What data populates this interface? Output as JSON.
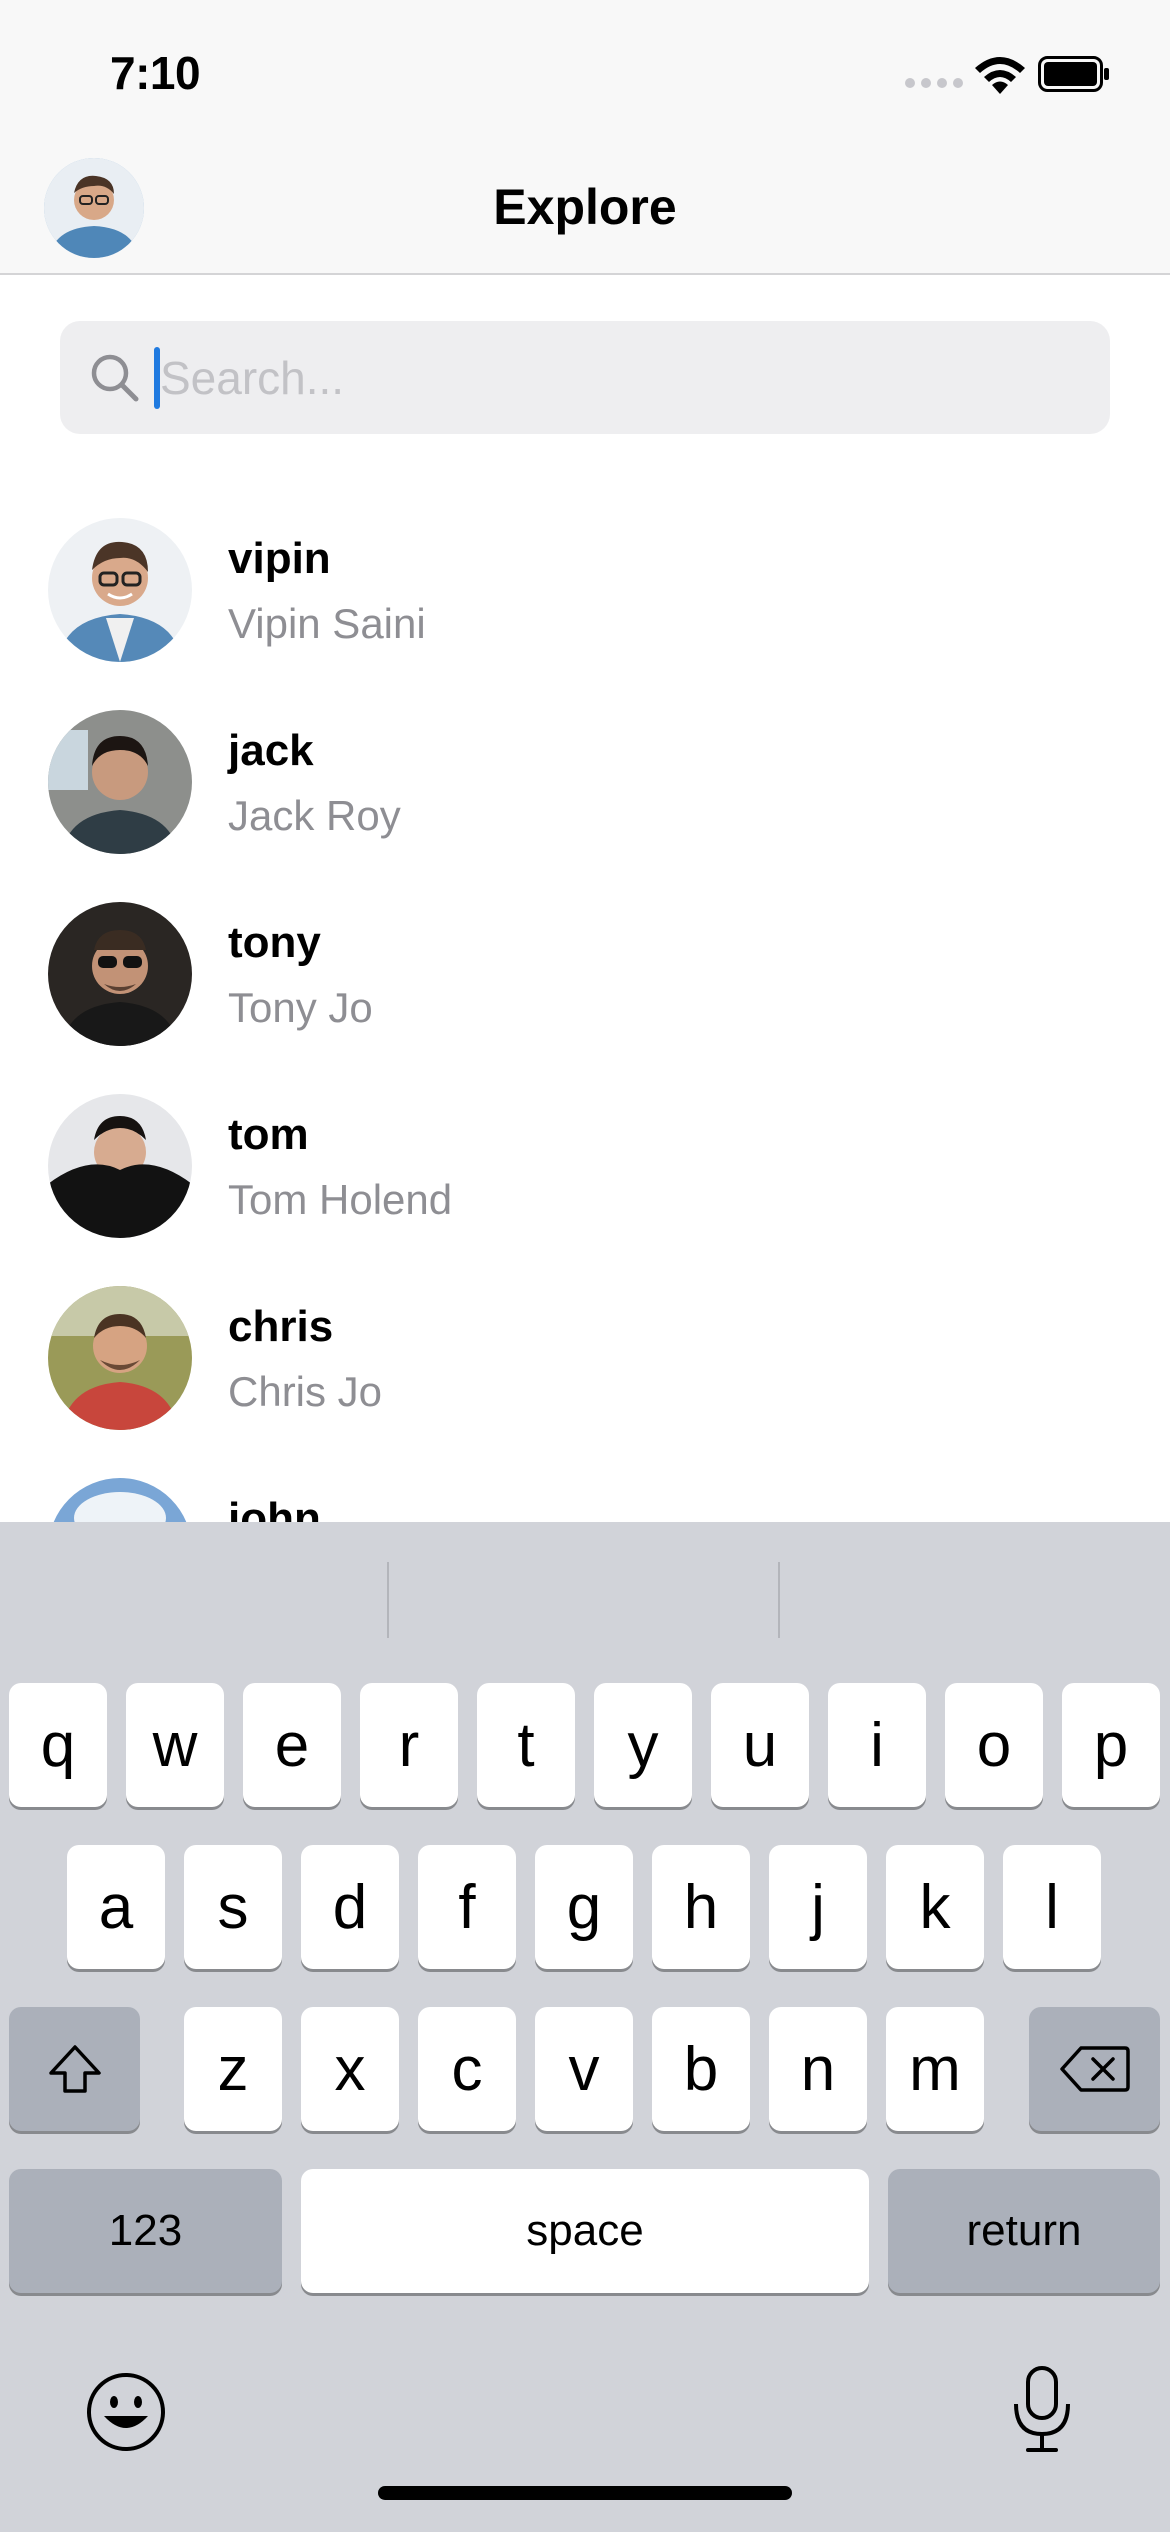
{
  "status_bar": {
    "time": "7:10"
  },
  "nav": {
    "title": "Explore"
  },
  "search": {
    "placeholder": "Search..."
  },
  "users": [
    {
      "username": "vipin",
      "full_name": "Vipin Saini"
    },
    {
      "username": "jack",
      "full_name": "Jack Roy"
    },
    {
      "username": "tony",
      "full_name": "Tony Jo"
    },
    {
      "username": "tom",
      "full_name": "Tom Holend"
    },
    {
      "username": "chris",
      "full_name": "Chris Jo"
    },
    {
      "username": "john",
      "full_name": ""
    }
  ],
  "keyboard": {
    "row1": [
      "q",
      "w",
      "e",
      "r",
      "t",
      "y",
      "u",
      "i",
      "o",
      "p"
    ],
    "row2": [
      "a",
      "s",
      "d",
      "f",
      "g",
      "h",
      "j",
      "k",
      "l"
    ],
    "row3": [
      "z",
      "x",
      "c",
      "v",
      "b",
      "n",
      "m"
    ],
    "numbers_label": "123",
    "space_label": "space",
    "return_label": "return",
    "icons": [
      "shift-icon",
      "delete-icon",
      "emoji-icon",
      "microphone-icon"
    ]
  }
}
